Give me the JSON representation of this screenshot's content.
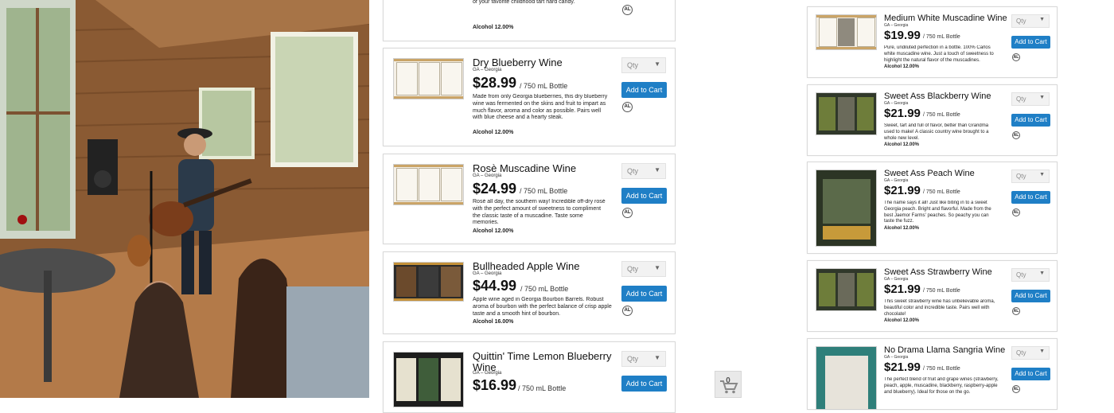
{
  "photo": {
    "alt_scene": "musician performing in wooden tasting room"
  },
  "common": {
    "qty_placeholder": "Qty",
    "add_to_cart_label": "Add to Cart",
    "allergen_badge": "AL",
    "unit_label": "/ 750 mL Bottle",
    "region": "GA – Georgia"
  },
  "cart": {
    "count": "0"
  },
  "colors": {
    "button_blue": "#1f7fc6",
    "card_border": "#d9d9d9"
  },
  "middle_products": [
    {
      "name": "",
      "price": "",
      "desc": "A true watermelon wine, made with real, GA watermelons! Uniquely tangy and sweet, reminiscent of your favorite childhood tart hard candy.",
      "alc": "Alcohol 12.00%"
    },
    {
      "name": "Dry Blueberry Wine",
      "price": "$28.99",
      "desc": "Made from only Georgia blueberries, this dry blueberry wine was fermented on the skins and fruit to impart as much flavor, aroma and color as possible. Pairs well with blue cheese and a hearty steak.",
      "alc": "Alcohol 12.00%"
    },
    {
      "name": "Rosè Muscadine Wine",
      "price": "$24.99",
      "desc": "Rosé all day, the southern way! Incredible off-dry rosé with the perfect amount of sweetness to compliment the classic taste of a muscadine. Taste some memories.",
      "alc": "Alcohol 12.00%"
    },
    {
      "name": "Bullheaded Apple Wine",
      "price": "$44.99",
      "desc": "Apple wine aged in Georgia Bourbon Barrels. Robust aroma of bourbon with the perfect balance of crisp apple taste and a smooth hint of bourbon.",
      "alc": "Alcohol 16.00%"
    },
    {
      "name": "Quittin' Time Lemon Blueberry Wine",
      "price": "$16.99",
      "desc": "",
      "alc": ""
    }
  ],
  "right_products": [
    {
      "name": "Medium White Muscadine Wine",
      "price": "$19.99",
      "desc": "Pure, undiluted perfection in a bottle. 100% Carlos white muscadine wine. Just a touch of sweetness to highlight the natural flavor of the muscadines.",
      "alc": "Alcohol 12.00%"
    },
    {
      "name": "Sweet Ass Blackberry Wine",
      "price": "$21.99",
      "desc": "Sweet, tart and full of flavor, better than Grandma used to make! A classic country wine brought to a whole new level.",
      "alc": "Alcohol 12.00%"
    },
    {
      "name": "Sweet Ass Peach Wine",
      "price": "$21.99",
      "desc": "The name says it all! Just like biting in to a sweet Georgia peach. Bright and flavorful. Made from the best Jaemor Farms' peaches. So peachy you can taste the fuzz.",
      "alc": "Alcohol 12.00%"
    },
    {
      "name": "Sweet Ass Strawberry Wine",
      "price": "$21.99",
      "desc": "This sweet strawberry wine has unbelievable aroma, beautiful color and incredible taste. Pairs well with chocolate!",
      "alc": "Alcohol 12.00%"
    },
    {
      "name": "No Drama Llama Sangria Wine",
      "price": "$21.99",
      "desc": "The perfect blend of fruit and grape wines (strawberry, peach, apple, muscadine, blackberry, raspberry-apple and blueberry). Ideal for those on the go.",
      "alc": ""
    }
  ]
}
